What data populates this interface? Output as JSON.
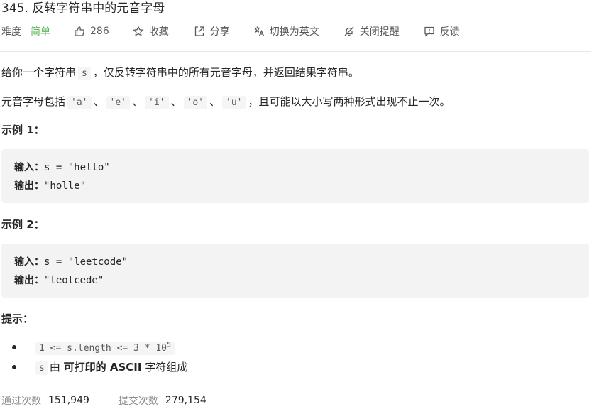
{
  "problem": {
    "title": "345. 反转字符串中的元音字母"
  },
  "toolbar": {
    "difficulty_label": "难度",
    "difficulty_value": "简单",
    "likes": "286",
    "favorite": "收藏",
    "share": "分享",
    "switch_lang": "切换为英文",
    "notify": "关闭提醒",
    "feedback": "反馈",
    "colors": {
      "difficulty": "#5cb85c",
      "text": "#595959"
    }
  },
  "description": {
    "p1_before": "给你一个字符串",
    "p1_code": "s",
    "p1_after": "，仅反转字符串中的所有元音字母，并返回结果字符串。",
    "p2_before": "元音字母包括",
    "vowels": [
      "'a'",
      "'e'",
      "'i'",
      "'o'",
      "'u'"
    ],
    "sep": "、",
    "p2_after": "，且可能以大小写两种形式出现不止一次。"
  },
  "example1": {
    "heading": "示例 1：",
    "input_label": "输入：",
    "input_value": "s = \"hello\"",
    "output_label": "输出：",
    "output_value": "\"holle\""
  },
  "example2": {
    "heading": "示例 2：",
    "input_label": "输入：",
    "input_value": "s = \"leetcode\"",
    "output_label": "输出：",
    "output_value": "\"leotcede\""
  },
  "hints": {
    "heading": "提示：",
    "item1_code": "1 <= s.length <= 3 * 10",
    "item1_sup": "5",
    "item2_code": "s",
    "item2_pre": "由",
    "item2_bold": "可打印的 ASCII",
    "item2_post": "字符组成"
  },
  "stats": {
    "accepted_label": "通过次数",
    "accepted_value": "151,949",
    "submitted_label": "提交次数",
    "submitted_value": "279,154"
  }
}
